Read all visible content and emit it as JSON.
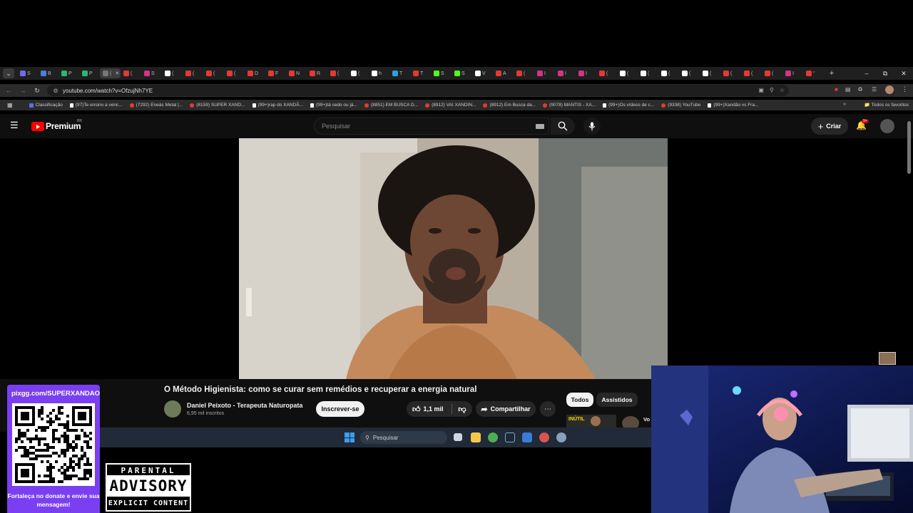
{
  "browser": {
    "tabs": [
      {
        "letter": "S",
        "color": "#6f6cf0"
      },
      {
        "letter": "B",
        "color": "#4a7fe0"
      },
      {
        "letter": "P",
        "color": "#2bb673"
      },
      {
        "letter": "P",
        "color": "#2bb673"
      },
      {
        "letter": "(",
        "color": "#777777",
        "active": true
      },
      {
        "letter": "(",
        "color": "#e53935"
      },
      {
        "letter": "S",
        "color": "#d63384"
      },
      {
        "letter": "(",
        "color": "#ffffff"
      },
      {
        "letter": "(",
        "color": "#e53935"
      },
      {
        "letter": "(",
        "color": "#e53935"
      },
      {
        "letter": "(",
        "color": "#e53935"
      },
      {
        "letter": "D",
        "color": "#e53935"
      },
      {
        "letter": "F",
        "color": "#e53935"
      },
      {
        "letter": "N",
        "color": "#e53935"
      },
      {
        "letter": "R",
        "color": "#e53935"
      },
      {
        "letter": "(",
        "color": "#e53935"
      },
      {
        "letter": "(",
        "color": "#ffffff"
      },
      {
        "letter": "h",
        "color": "#ffffff"
      },
      {
        "letter": "T",
        "color": "#2aa1dd"
      },
      {
        "letter": "T",
        "color": "#e53935"
      },
      {
        "letter": "S",
        "color": "#53fc18"
      },
      {
        "letter": "S",
        "color": "#53fc18"
      },
      {
        "letter": "V",
        "color": "#ffffff"
      },
      {
        "letter": "A",
        "color": "#e53935"
      },
      {
        "letter": "(",
        "color": "#e53935"
      },
      {
        "letter": "I",
        "color": "#d63384"
      },
      {
        "letter": "I",
        "color": "#d63384"
      },
      {
        "letter": "I",
        "color": "#d63384"
      },
      {
        "letter": "(",
        "color": "#e53935"
      },
      {
        "letter": "(",
        "color": "#ffffff"
      },
      {
        "letter": "(",
        "color": "#ffffff"
      },
      {
        "letter": "(",
        "color": "#ffffff"
      },
      {
        "letter": "(",
        "color": "#ffffff"
      },
      {
        "letter": "(",
        "color": "#ffffff"
      },
      {
        "letter": "(",
        "color": "#e53935"
      },
      {
        "letter": "(",
        "color": "#e53935"
      },
      {
        "letter": "(",
        "color": "#e53935"
      },
      {
        "letter": "I",
        "color": "#d63384"
      },
      {
        "letter": "“",
        "color": "#e53935"
      }
    ],
    "new_tab": "+",
    "url": "youtube.com/watch?v=OfzujNh7YE",
    "bookmarks": [
      {
        "label": "Classificação",
        "kind": "cl"
      },
      {
        "label": "(97)Te ensino a venc...",
        "kind": "tk"
      },
      {
        "label": "(7292) Eneás Metal |...",
        "kind": "yt"
      },
      {
        "label": "(8159) SUPER XAND...",
        "kind": "yt"
      },
      {
        "label": "(99+)rap do XANDÃ...",
        "kind": "tk"
      },
      {
        "label": "(99+)tá cedo ou já...",
        "kind": "tk"
      },
      {
        "label": "(8851) EM BUSCA D...",
        "kind": "yt"
      },
      {
        "label": "(8912) VAI XANDIN...",
        "kind": "yt"
      },
      {
        "label": "(8912) Em Busca da...",
        "kind": "yt"
      },
      {
        "label": "(9078) MANTIS - XA...",
        "kind": "yt"
      },
      {
        "label": "(99+)Os vídeos de c...",
        "kind": "tk"
      },
      {
        "label": "(9338) YouTube",
        "kind": "yt"
      },
      {
        "label": "(99+)Xandão vs Fra...",
        "kind": "tk"
      }
    ],
    "bookmarks_more": "»",
    "all_bookmarks": "Todos os favoritos"
  },
  "youtube": {
    "logo_text": "Premium",
    "region": "BR",
    "search_placeholder": "Pesquisar",
    "create_label": "Criar",
    "notif_badge": "9+",
    "video_title": "O Método Higienista: como se curar sem remédios e recuperar a energia natural",
    "channel_name": "Daniel Peixoto - Terapeuta Naturopata",
    "subscribers": "6,95 mil inscritos",
    "subscribe_label": "Inscrever-se",
    "likes": "1,1 mil",
    "share_label": "Compartilhar",
    "chips": [
      "Todos",
      "Assistidos"
    ],
    "rec_thumb_text": "INÚTIL",
    "rec_title": "Vo"
  },
  "taskbar": {
    "search_placeholder": "Pesquisar"
  },
  "overlay": {
    "pix_url": "pixgg.com/SUPERXANDAO",
    "pix_message": "Fortaleça no donate e envie sua mensagem!",
    "advisory_top": "PARENTAL",
    "advisory_mid": "ADVISORY",
    "advisory_bot": "EXPLICIT CONTENT"
  },
  "colors": {
    "brand_red": "#ff0000",
    "pix_purple": "#7b3ff2",
    "taskbar": "#202a38"
  }
}
